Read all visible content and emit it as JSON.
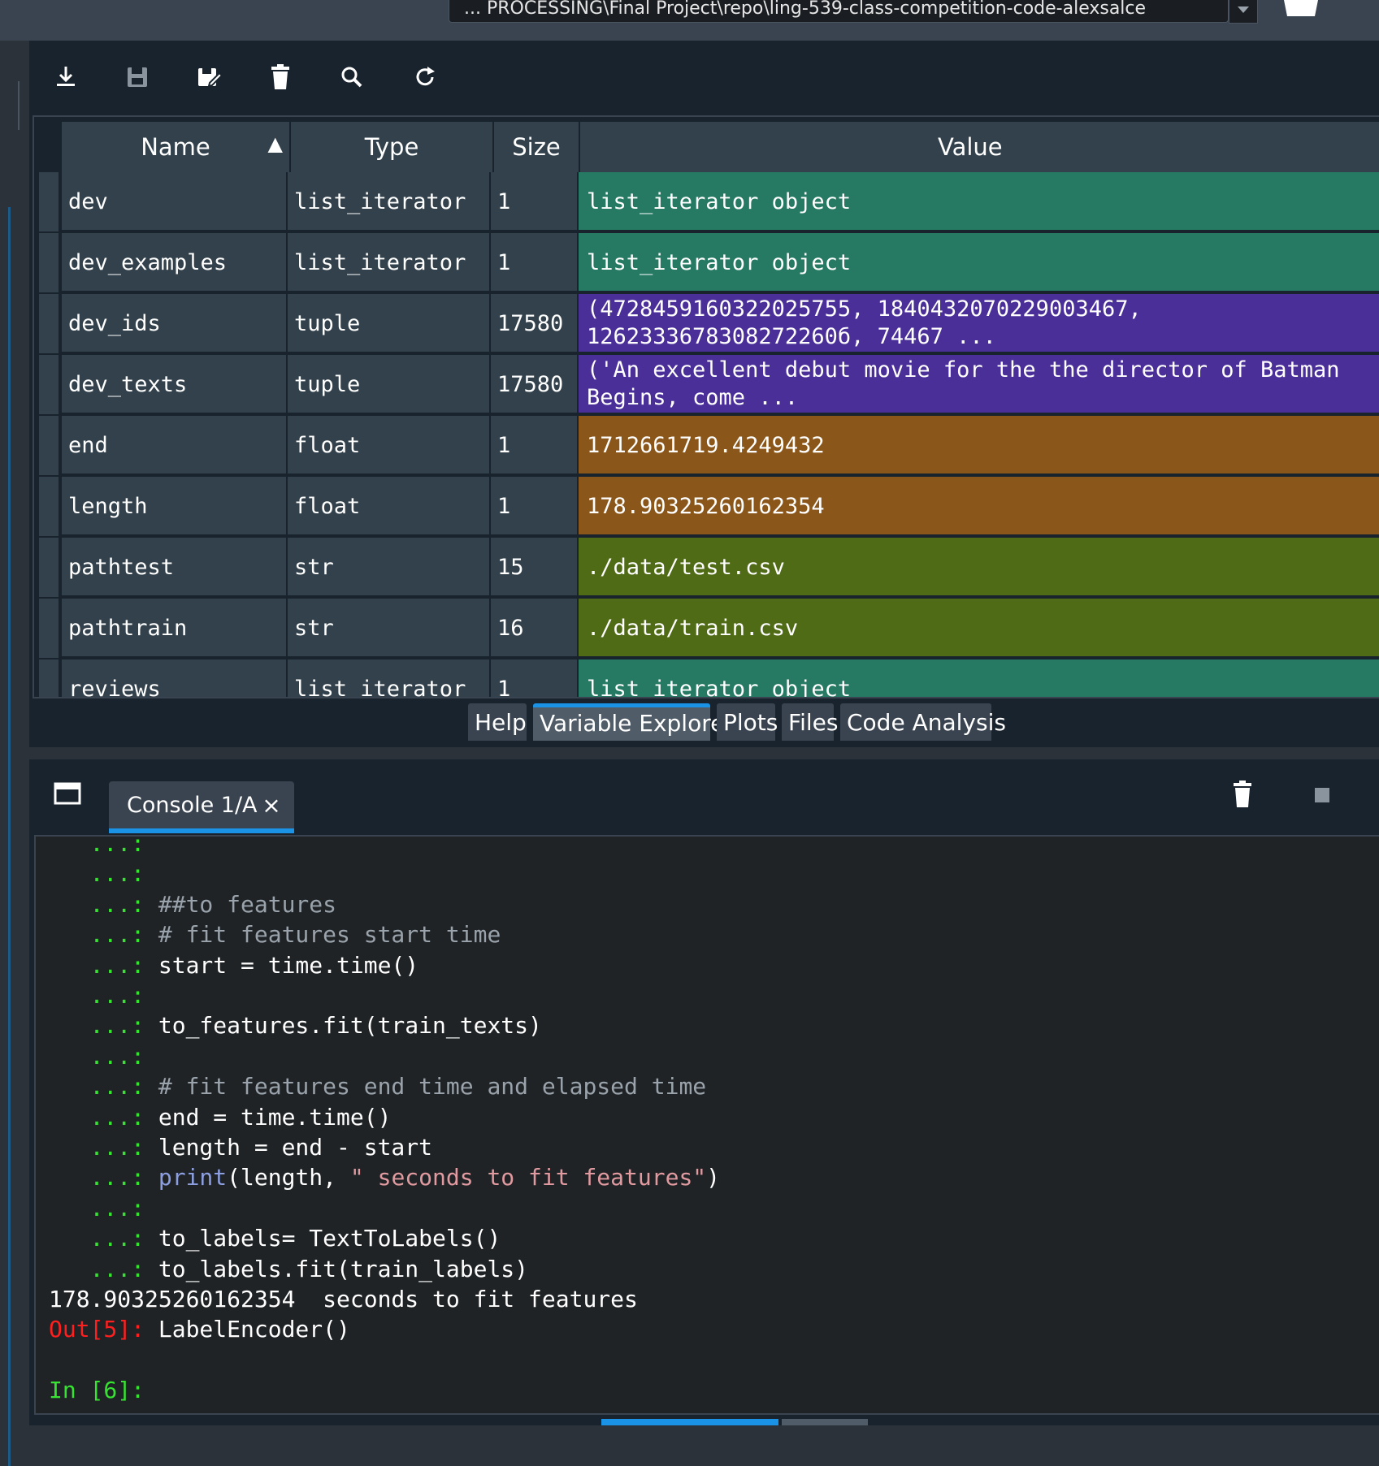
{
  "topbar": {
    "path": "... PROCESSING\\Final Project\\repo\\ling-539-class-competition-code-alexsalce"
  },
  "toolbar": {
    "buttons": [
      {
        "name": "import-data-icon"
      },
      {
        "name": "save-data-icon"
      },
      {
        "name": "save-as-icon"
      },
      {
        "name": "remove-all-icon"
      },
      {
        "name": "search-icon"
      },
      {
        "name": "refresh-icon"
      }
    ]
  },
  "variable_explorer": {
    "columns": {
      "name": "Name",
      "type": "Type",
      "size": "Size",
      "value": "Value"
    },
    "sort_indicator": "▲",
    "rows": [
      {
        "name": "dev",
        "type": "list_iterator",
        "size": "1",
        "value": "list_iterator object",
        "color": "#267a63"
      },
      {
        "name": "dev_examples",
        "type": "list_iterator",
        "size": "1",
        "value": "list_iterator object",
        "color": "#267a63"
      },
      {
        "name": "dev_ids",
        "type": "tuple",
        "size": "17580",
        "value": "(4728459160322025755, 1840432070229003467, 1262333678308272260б, 74467 ...",
        "color": "#4b2f99"
      },
      {
        "name": "dev_texts",
        "type": "tuple",
        "size": "17580",
        "value": "('An excellent debut movie for the the director of Batman Begins, come ...",
        "color": "#4b2f99"
      },
      {
        "name": "end",
        "type": "float",
        "size": "1",
        "value": "1712661719.4249432",
        "color": "#8a5619"
      },
      {
        "name": "length",
        "type": "float",
        "size": "1",
        "value": "178.90325260162354",
        "color": "#8a5619"
      },
      {
        "name": "pathtest",
        "type": "str",
        "size": "15",
        "value": "./data/test.csv",
        "color": "#506b16"
      },
      {
        "name": "pathtrain",
        "type": "str",
        "size": "16",
        "value": "./data/train.csv",
        "color": "#506b16"
      },
      {
        "name": "reviews",
        "type": "list_iterator",
        "size": "1",
        "value": "list_iterator object",
        "color": "#267a63"
      }
    ]
  },
  "pane_tabs": [
    "Help",
    "Variable Explorer",
    "Plots",
    "Files",
    "Code Analysis"
  ],
  "console": {
    "tab_label": "Console 1/A",
    "close": "×",
    "lines": [
      {
        "p": "   ...:",
        "segs": []
      },
      {
        "p": "   ...:",
        "segs": []
      },
      {
        "p": "   ...: ",
        "segs": [
          {
            "t": "##to features",
            "c": "cmt"
          }
        ]
      },
      {
        "p": "   ...: ",
        "segs": [
          {
            "t": "# fit features start time",
            "c": "cmt"
          }
        ]
      },
      {
        "p": "   ...: ",
        "segs": [
          {
            "t": "start = time.time()",
            "c": ""
          }
        ]
      },
      {
        "p": "   ...:",
        "segs": []
      },
      {
        "p": "   ...: ",
        "segs": [
          {
            "t": "to_features.fit(train_texts)",
            "c": ""
          }
        ]
      },
      {
        "p": "   ...:",
        "segs": []
      },
      {
        "p": "   ...: ",
        "segs": [
          {
            "t": "# fit features end time and elapsed time",
            "c": "cmt"
          }
        ]
      },
      {
        "p": "   ...: ",
        "segs": [
          {
            "t": "end = time.time()",
            "c": ""
          }
        ]
      },
      {
        "p": "   ...: ",
        "segs": [
          {
            "t": "length = end - start",
            "c": ""
          }
        ]
      },
      {
        "p": "   ...: ",
        "segs": [
          {
            "t": "print",
            "c": "kw"
          },
          {
            "t": "(length, ",
            "c": ""
          },
          {
            "t": "\" seconds to fit features\"",
            "c": "strl"
          },
          {
            "t": ")",
            "c": ""
          }
        ]
      },
      {
        "p": "   ...:",
        "segs": []
      },
      {
        "p": "   ...: ",
        "segs": [
          {
            "t": "to_labels= TextToLabels()",
            "c": ""
          }
        ]
      },
      {
        "p": "   ...: ",
        "segs": [
          {
            "t": "to_labels.fit(train_labels)",
            "c": ""
          }
        ]
      },
      {
        "p": "",
        "segs": [
          {
            "t": "178.90325260162354  seconds to fit features",
            "c": ""
          }
        ]
      },
      {
        "p": "",
        "segs": [
          {
            "t": "Out[5]: ",
            "c": "outp"
          },
          {
            "t": "LabelEncoder()",
            "c": ""
          }
        ]
      },
      {
        "p": "",
        "segs": []
      },
      {
        "p": "",
        "segs": [
          {
            "t": "In [6]:",
            "c": "inp"
          }
        ]
      }
    ]
  }
}
